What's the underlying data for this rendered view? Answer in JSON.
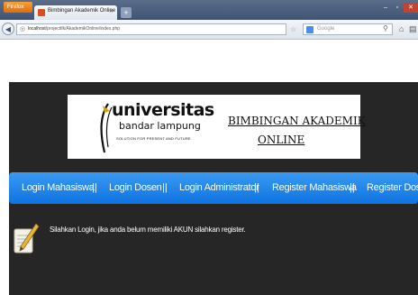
{
  "browser": {
    "app_button_label": "Firefox",
    "tab_title": "Bimbingan Akademik Online",
    "new_tab_label": "+",
    "url_host": "localhost",
    "url_path": "/projectifk/AkademikOnline/index.php",
    "search_placeholder": "Google"
  },
  "banner": {
    "logo_line1": "universitas",
    "logo_line2": "bandar lampung",
    "logo_tagline": "SOLUTION FOR PRESENT AND FUTURE",
    "title_line1": "BIMBINGAN AKADEMIK",
    "title_line2": "ONLINE"
  },
  "menu": {
    "items": [
      "Login Mahasiswa",
      "Login Dosen",
      "Login Administrator",
      "Register Mahasiswa",
      "Register Dosen"
    ],
    "separator": "||"
  },
  "info": {
    "message": "Silahkan Login, jika anda belum memiliki AKUN silahkan register."
  },
  "colors": {
    "page_background": "#262626",
    "menu_bar": "#1a7ee8",
    "menu_text": "#ffffff"
  }
}
